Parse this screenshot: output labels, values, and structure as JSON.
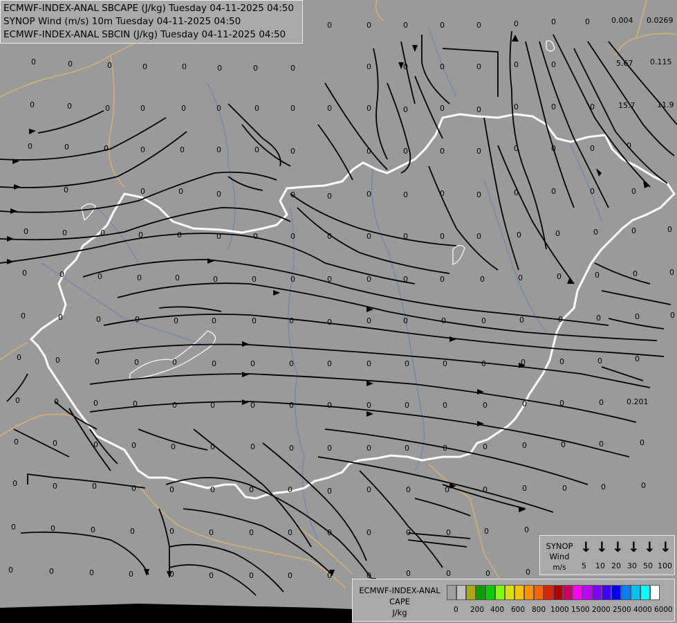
{
  "header": {
    "line1": "ECMWF-INDEX-ANAL SBCAPE (J/kg) Tuesday 04-11-2025 04:50",
    "line2": "SYNOP Wind (m/s) 10m Tuesday 04-11-2025 04:50",
    "line3": "ECMWF-INDEX-ANAL SBCIN (J/kg) Tuesday 04-11-2025 04:50"
  },
  "synop_legend": {
    "title": "SYNOP\nWind",
    "unit": "m/s",
    "speeds": [
      "5",
      "10",
      "20",
      "30",
      "50",
      "100"
    ]
  },
  "cape_legend": {
    "title": "ECMWF-INDEX-ANAL\nCAPE\nJ/kg",
    "colors": [
      "#a0a0a0",
      "#bfbfbf",
      "#a8a800",
      "#00a000",
      "#00d000",
      "#80ff00",
      "#e0e000",
      "#ffc000",
      "#ff9000",
      "#ff6000",
      "#e02000",
      "#b00000",
      "#d00060",
      "#ff00ff",
      "#c000ff",
      "#8000ff",
      "#4000ff",
      "#0000ff",
      "#0080ff",
      "#00c0ff",
      "#00ffff",
      "#ffffff"
    ],
    "labels": [
      "0",
      "200",
      "400",
      "600",
      "800",
      "1000",
      "1500",
      "2000",
      "2500",
      "4000",
      "6000"
    ]
  },
  "colors": {
    "background": "#9a9a9a",
    "border": "#ffffff",
    "neighbor_border": "#d8b070",
    "rivers": "#5f80b0",
    "streamlines": "#000000"
  },
  "map_values": [
    "0.004",
    "0.0269",
    "5.67",
    "0.115",
    "15.7",
    "11.9",
    "0.201"
  ],
  "cin_zero_label": "0"
}
